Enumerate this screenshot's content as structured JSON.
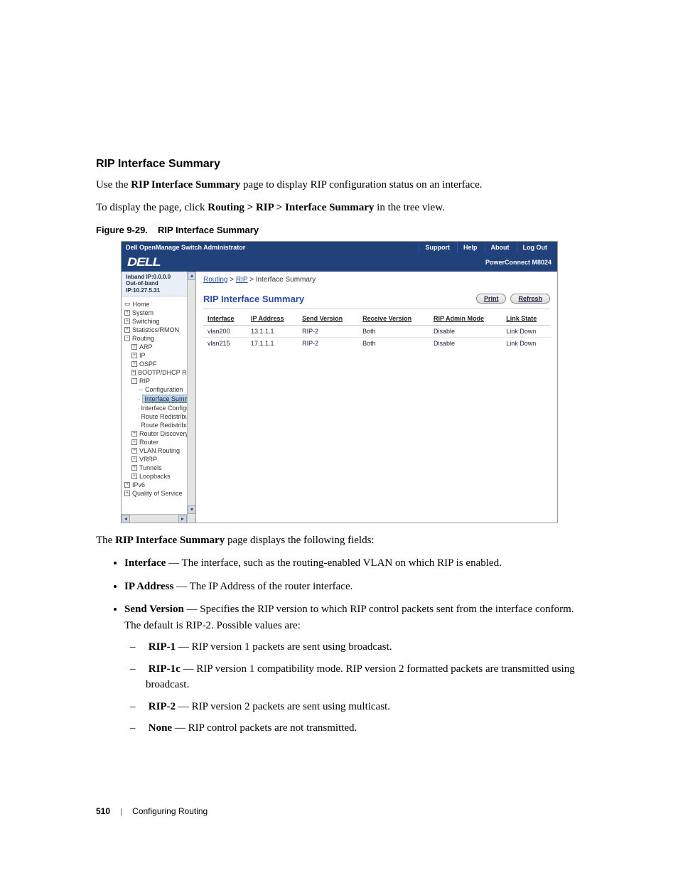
{
  "heading": "RIP Interface Summary",
  "intro1_pre": "Use the ",
  "intro1_bold": "RIP Interface Summary",
  "intro1_post": " page to display RIP configuration status on an interface.",
  "intro2_pre": "To display the page, click ",
  "intro2_bold": "Routing > RIP > Interface Summary",
  "intro2_post": " in the tree view.",
  "figure": {
    "num": "Figure 9-29.",
    "title": "RIP Interface Summary"
  },
  "screenshot": {
    "titlebar": {
      "title": "Dell OpenManage Switch Administrator",
      "links": [
        "Support",
        "Help",
        "About",
        "Log Out"
      ]
    },
    "logo_text": "DELL",
    "model": "PowerConnect M8024",
    "ip1": "Inband IP:0.0.0.0",
    "ip2": "Out-of-band IP:10.27.5.31",
    "tree": {
      "home": "Home",
      "system": "System",
      "switching": "Switching",
      "stats": "Statistics/RMON",
      "routing": "Routing",
      "arp": "ARP",
      "ip": "IP",
      "ospf": "OSPF",
      "bootp": "BOOTP/DHCP Relay",
      "rip": "RIP",
      "conf": "Configuration",
      "isum": "Interface Summa",
      "iconf": "Interface Configura",
      "rr1": "Route Redistributio",
      "rr2": "Route Redistributio",
      "rdisc": "Router Discovery",
      "router": "Router",
      "vlanr": "VLAN Routing",
      "vrrp": "VRRP",
      "tunnels": "Tunnels",
      "loop": "Loopbacks",
      "ipv6": "IPv6",
      "qos": "Quality of Service"
    },
    "breadcrumb": {
      "a": "Routing",
      "b": "RIP",
      "c": "Interface Summary"
    },
    "panel_title": "RIP Interface Summary",
    "buttons": {
      "print": "Print",
      "refresh": "Refresh"
    },
    "table": {
      "headers": [
        "Interface",
        "IP Address",
        "Send Version",
        "Receive Version",
        "RIP Admin Mode",
        "Link State"
      ],
      "rows": [
        [
          "vlan200",
          "13.1.1.1",
          "RIP-2",
          "Both",
          "Disable",
          "Link Down"
        ],
        [
          "vlan215",
          "17.1.1.1",
          "RIP-2",
          "Both",
          "Disable",
          "Link Down"
        ]
      ]
    }
  },
  "after_intro_pre": "The ",
  "after_intro_bold": "RIP Interface Summary",
  "after_intro_post": " page displays the following fields:",
  "fields": {
    "interface": {
      "term": "Interface",
      "desc": " — The interface, such as the routing-enabled VLAN on which RIP is enabled."
    },
    "ip": {
      "term": "IP Address",
      "desc": " — The IP Address of the router interface."
    },
    "send": {
      "term": "Send Version",
      "desc": " — Specifies the RIP version to which RIP control packets sent from the interface conform. The default is RIP-2. Possible values are:"
    },
    "send_sub": {
      "rip1": {
        "term": "RIP-1",
        "desc": " — RIP version 1 packets are sent using broadcast."
      },
      "rip1c": {
        "term": "RIP-1c",
        "desc": " — RIP version 1 compatibility mode. RIP version 2 formatted packets are transmitted using broadcast."
      },
      "rip2": {
        "term": "RIP-2",
        "desc": " — RIP version 2 packets are sent using multicast."
      },
      "none": {
        "term": "None",
        "desc": " — RIP control packets are not transmitted."
      }
    }
  },
  "footer": {
    "page": "510",
    "section": "Configuring Routing"
  }
}
